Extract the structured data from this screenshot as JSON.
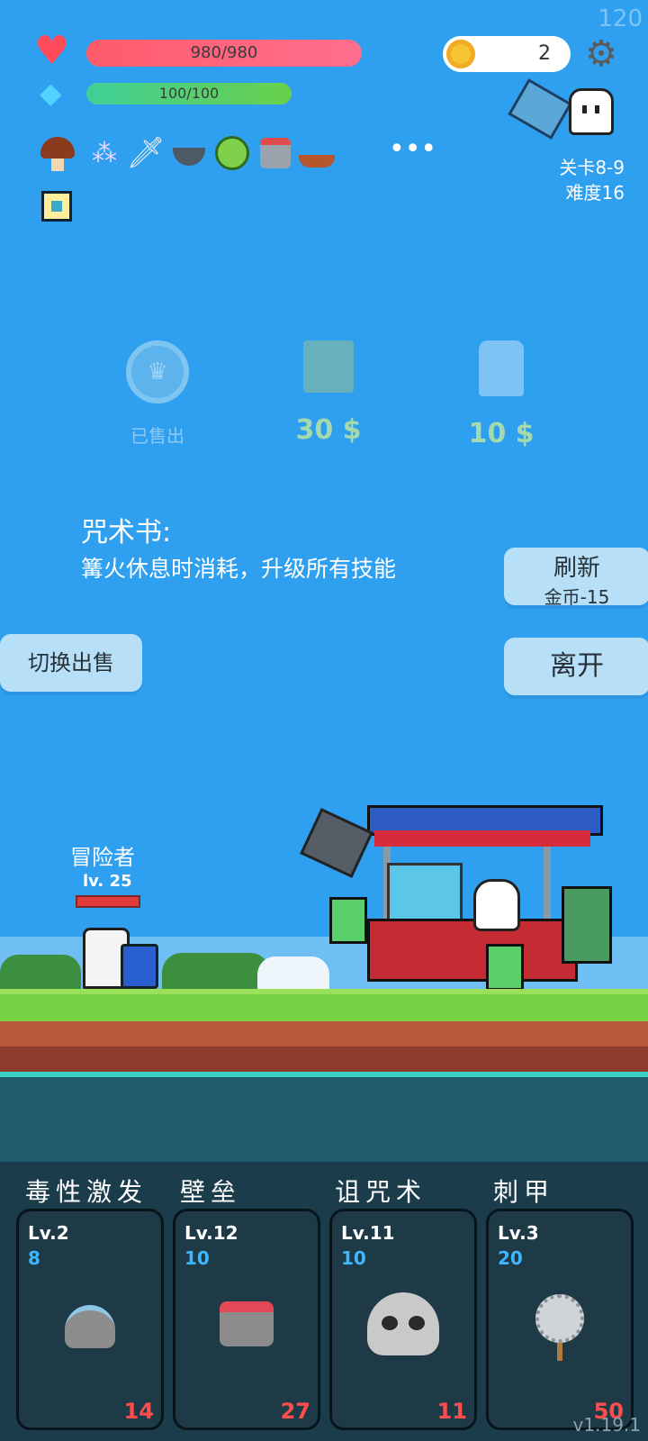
{
  "fps": "120",
  "hud": {
    "hp": "980/980",
    "mana": "100/100",
    "coins": "2",
    "level_line1": "关卡8-9",
    "level_line2": "难度16"
  },
  "relics": {
    "items": [
      "mushroom-icon",
      "orbs-icon",
      "sword-icon",
      "mortar-icon",
      "lime-icon",
      "armor-icon",
      "ship-icon"
    ],
    "more": "•••",
    "extra": "lamp-icon"
  },
  "shop": {
    "items": [
      {
        "label": "已售出",
        "price": ""
      },
      {
        "label": "",
        "price": "30 $"
      },
      {
        "label": "",
        "price": "10 $"
      }
    ],
    "desc_title": "咒术书:",
    "desc_text": "篝火休息时消耗，升级所有技能"
  },
  "buttons": {
    "refresh": "刷新",
    "refresh_cost": "金币-15",
    "leave": "离开",
    "switch": "切换出售"
  },
  "hero": {
    "name": "冒险者",
    "level": "lv. 25"
  },
  "skills": [
    {
      "name": "毒性激发",
      "level": "Lv.2",
      "cost": "8",
      "value": "14",
      "icon": "horned-helmet-icon"
    },
    {
      "name": "壁垒",
      "level": "Lv.12",
      "cost": "10",
      "value": "27",
      "icon": "chest-armor-icon"
    },
    {
      "name": "诅咒术",
      "level": "Lv.11",
      "cost": "10",
      "value": "11",
      "icon": "skull-icon"
    },
    {
      "name": "刺甲",
      "level": "Lv.3",
      "cost": "20",
      "value": "50",
      "icon": "spiked-mace-icon"
    }
  ],
  "version": "v1.19.1",
  "colors": {
    "sky": "#2f9ff0",
    "grass": "#79d246",
    "panel": "#1b3c4b",
    "accent_red": "#ff4d4d",
    "accent_blue": "#3fb7ff"
  }
}
